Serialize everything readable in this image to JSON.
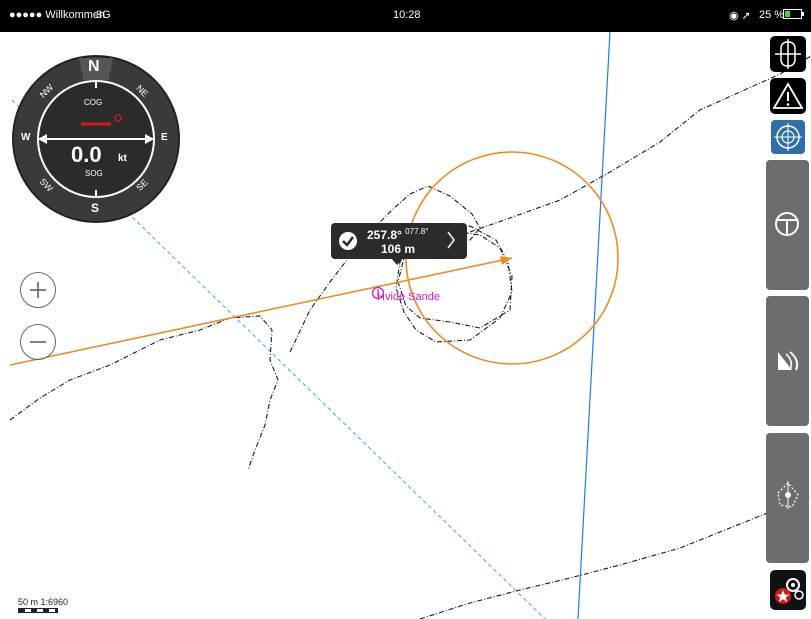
{
  "status_bar": {
    "carrier": "●●●●● Willkommen",
    "network": "3G",
    "time": "10:28",
    "battery": "25 %"
  },
  "compass": {
    "cardinals": {
      "north": "N",
      "south": "S",
      "east": "E",
      "west": "W"
    },
    "intercardinals": {
      "nw": "NW",
      "ne": "NE",
      "sw": "SW",
      "se": "SE"
    },
    "cog_label": "COG",
    "speed_value": "0.0",
    "speed_unit": "kt",
    "sog_label": "SOG"
  },
  "zoom": {
    "in_symbol": "+",
    "out_symbol": "−"
  },
  "route_popup": {
    "bearing": "257.8°",
    "reciprocal": "077.8°",
    "distance": "106 m"
  },
  "place_label": "Hvide Sande",
  "scale": {
    "text": "50 m  1:6960"
  },
  "colors": {
    "route": "#f08a24",
    "track": "#1a1a1a",
    "blue_line": "#1e7fe0",
    "place": "#c81ec8",
    "panel": "#6d6d6d",
    "active_button": "#2f6ea8"
  },
  "right_rail": {
    "icons": [
      "ship-cross-icon",
      "warning-icon",
      "compass-rose-icon",
      "steering-wheel-icon",
      "sail-icon",
      "mob-crosshair-icon",
      "settings-gears-icon"
    ]
  }
}
